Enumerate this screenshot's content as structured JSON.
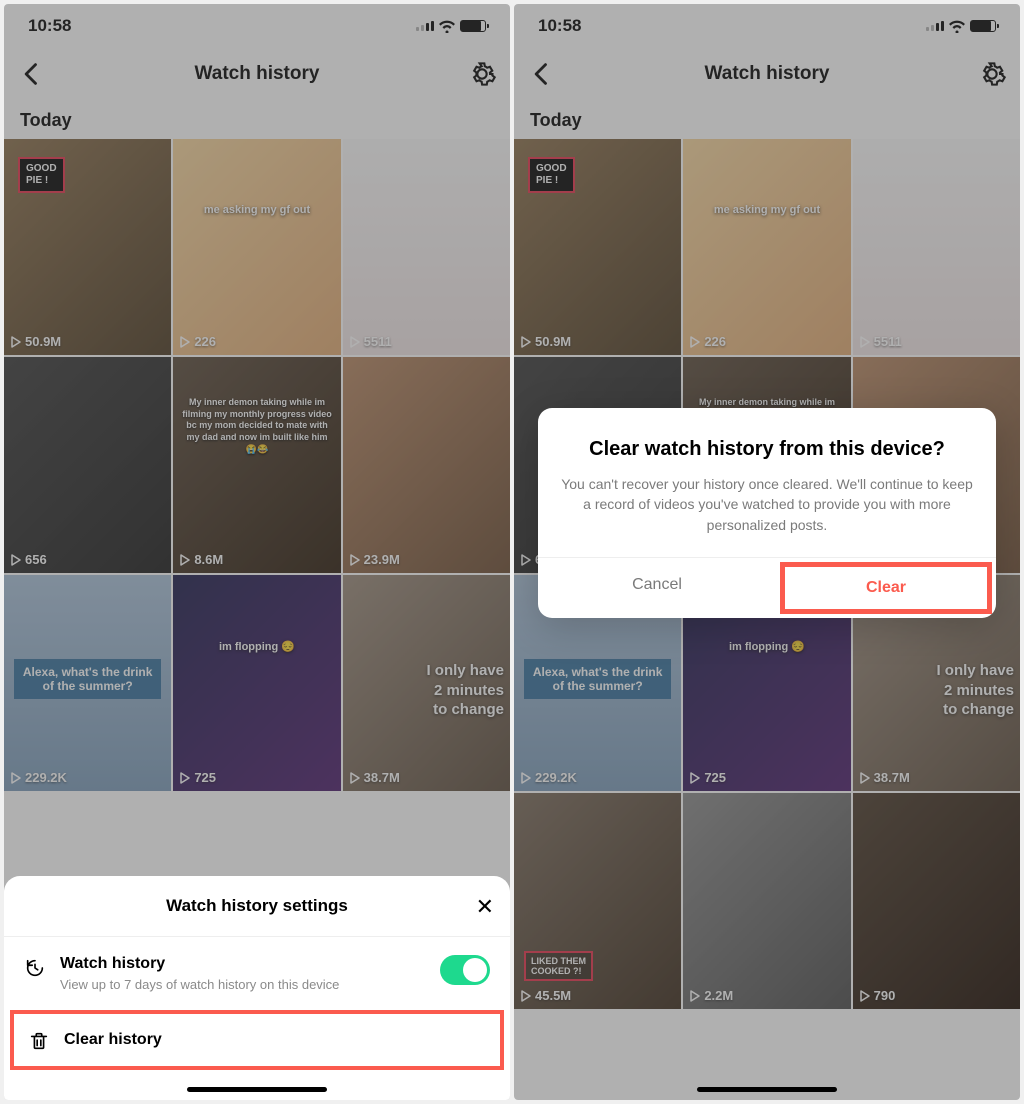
{
  "status": {
    "time": "10:58"
  },
  "header": {
    "title": "Watch history"
  },
  "section": {
    "today": "Today"
  },
  "tiles": [
    {
      "views": "50.9M",
      "badge": "GOOD\nPIE !",
      "bg": "bg1"
    },
    {
      "views": "226",
      "caption": "me asking my gf out",
      "bg": "bg2"
    },
    {
      "views": "5511",
      "bg": "bg3"
    },
    {
      "views": "656",
      "bg": "bg4"
    },
    {
      "views": "8.6M",
      "caption_white": "My inner demon taking while im filming my monthly progress video bc my mom decided to mate with my dad and now im built like him 😭😂",
      "bg": "bg5"
    },
    {
      "views": "23.9M",
      "bg": "bg6"
    },
    {
      "views": "229.2K",
      "caption_blue": "Alexa, what's the drink of the summer?",
      "bg": "bg7"
    },
    {
      "views": "725",
      "caption": "im flopping 😔",
      "bg": "bg8"
    },
    {
      "views": "38.7M",
      "caption_right": "I only have\n2 minutes\nto change",
      "bg": "bg9"
    },
    {
      "views": "45.5M",
      "badge_bottom": "LIKED THEM\nCOOKED ?!",
      "bg": "bg10"
    },
    {
      "views": "2.2M",
      "bg": "bg11"
    },
    {
      "views": "790",
      "bg": "bg12"
    }
  ],
  "sheet": {
    "title": "Watch history settings",
    "row1_title": "Watch history",
    "row1_subtitle": "View up to 7 days of watch history on this device",
    "row2_title": "Clear history"
  },
  "dialog": {
    "title": "Clear watch history from this device?",
    "body": "You can't recover your history once cleared. We'll continue to keep a record of videos you've watched to provide you with more personalized posts.",
    "cancel": "Cancel",
    "clear": "Clear"
  }
}
